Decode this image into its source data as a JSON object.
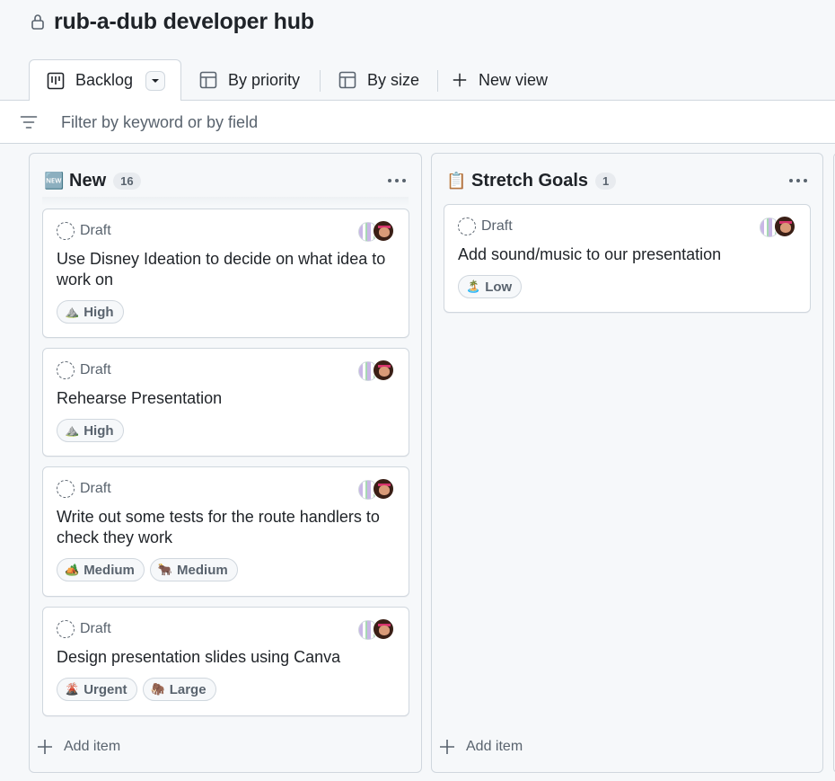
{
  "project": {
    "title": "rub-a-dub developer hub",
    "lock_icon": "lock-icon"
  },
  "tabs": [
    {
      "label": "Backlog",
      "icon": "board-icon",
      "active": true
    },
    {
      "label": "By priority",
      "icon": "table-icon"
    },
    {
      "label": "By size",
      "icon": "table-icon"
    },
    {
      "label": "New view",
      "icon": "plus-icon"
    }
  ],
  "filter": {
    "placeholder": "Filter by keyword or by field"
  },
  "columns": [
    {
      "emoji": "🆕",
      "title": "New",
      "count": "16",
      "add_label": "Add item",
      "cards": [
        {
          "status": "Draft",
          "title": "Use Disney Ideation to decide on what idea to work on",
          "tags": [
            {
              "emoji": "⛰️",
              "label": "High"
            }
          ]
        },
        {
          "status": "Draft",
          "title": "Rehearse Presentation",
          "tags": [
            {
              "emoji": "⛰️",
              "label": "High"
            }
          ]
        },
        {
          "status": "Draft",
          "title": "Write out some tests for the route handlers to check they work",
          "tags": [
            {
              "emoji": "🏕️",
              "label": "Medium"
            },
            {
              "emoji": "🐂",
              "label": "Medium"
            }
          ]
        },
        {
          "status": "Draft",
          "title": "Design presentation slides using Canva",
          "tags": [
            {
              "emoji": "🌋",
              "label": "Urgent"
            },
            {
              "emoji": "🦣",
              "label": "Large"
            }
          ]
        }
      ]
    },
    {
      "emoji": "📋",
      "title": "Stretch Goals",
      "count": "1",
      "add_label": "Add item",
      "cards": [
        {
          "status": "Draft",
          "title": "Add sound/music to our presentation",
          "tags": [
            {
              "emoji": "🏝️",
              "label": "Low"
            }
          ]
        }
      ]
    }
  ]
}
